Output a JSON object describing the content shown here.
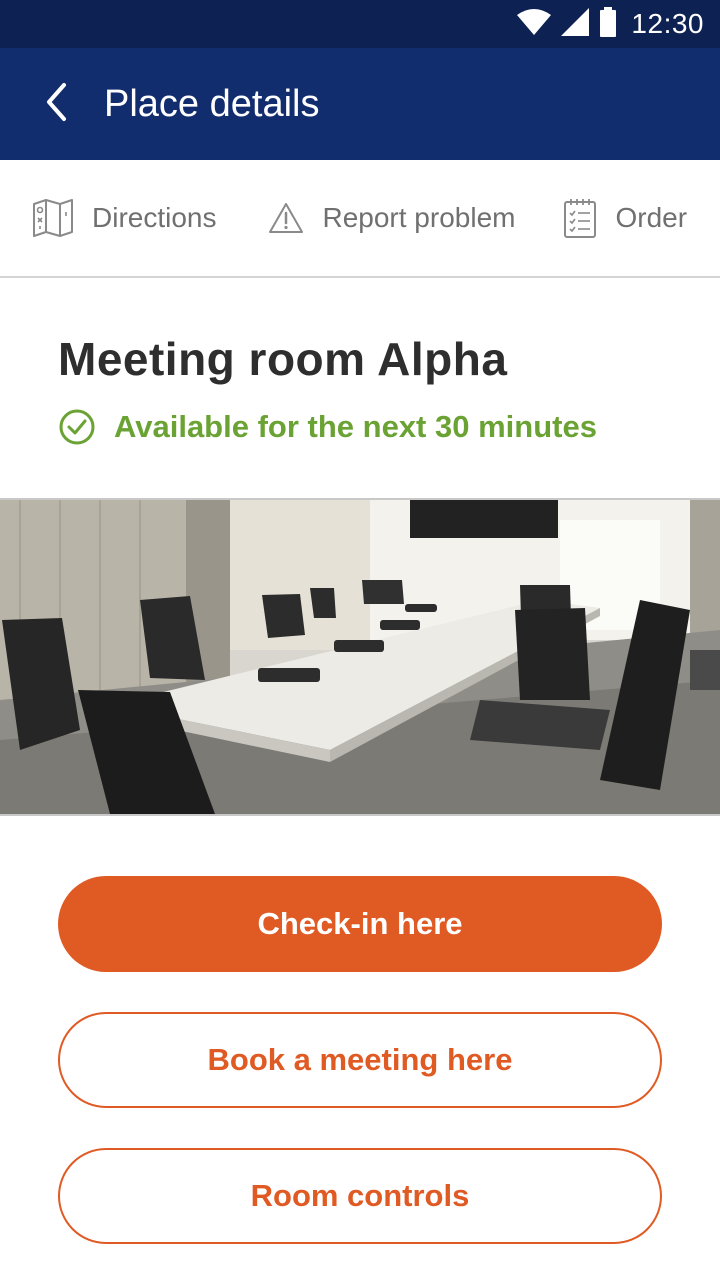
{
  "status_bar": {
    "time": "12:30",
    "icons": [
      "wifi-icon",
      "signal-icon",
      "battery-icon"
    ]
  },
  "app_bar": {
    "title": "Place details",
    "back_icon": "chevron-left-icon"
  },
  "actions": [
    {
      "label": "Directions",
      "icon": "map-icon"
    },
    {
      "label": "Report problem",
      "icon": "warning-icon"
    },
    {
      "label": "Order",
      "icon": "clipboard-list-icon"
    }
  ],
  "room": {
    "name": "Meeting room Alpha",
    "availability": "Available for the next 30 minutes",
    "availability_icon": "check-circle-icon",
    "photo": "conference-room-photo"
  },
  "buttons": {
    "checkin": "Check-in here",
    "book": "Book a meeting here",
    "controls": "Room controls"
  },
  "colors": {
    "status_bar": "#0d2253",
    "app_bar": "#122d6e",
    "accent": "#e05a24",
    "available": "#6aa234",
    "action_text": "#707070",
    "title_text": "#2e2e2e"
  }
}
